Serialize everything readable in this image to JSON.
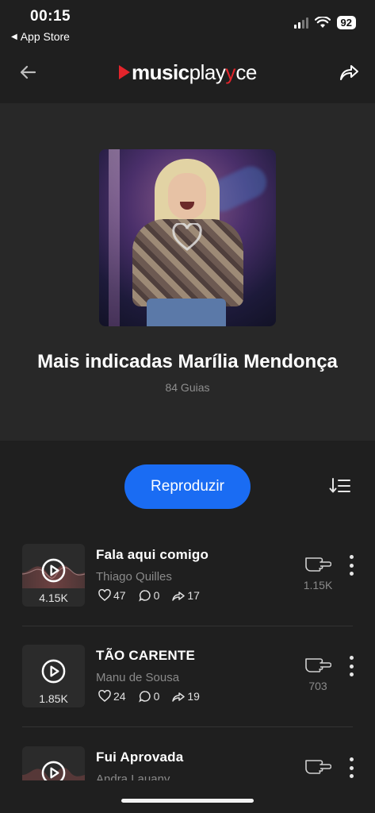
{
  "status_bar": {
    "time": "00:15",
    "back_app": "App Store",
    "battery": "92"
  },
  "header": {
    "logo_bold": "music",
    "logo_light": "play",
    "logo_accent": "y",
    "logo_tail": "ce"
  },
  "playlist": {
    "title": "Mais indicadas Marília Mendonça",
    "subtitle": "84 Guias"
  },
  "controls": {
    "play_label": "Reproduzir"
  },
  "tracks": [
    {
      "title": "Fala aqui comigo",
      "artist": "Thiago Quilles",
      "views": "4.15K",
      "likes": "47",
      "comments": "0",
      "shares": "17",
      "recommendations": "1.15K"
    },
    {
      "title": "TÃO CARENTE",
      "artist": "Manu de Sousa",
      "views": "1.85K",
      "likes": "24",
      "comments": "0",
      "shares": "19",
      "recommendations": "703"
    },
    {
      "title": "Fui Aprovada",
      "artist": "Andra Lauany",
      "views": "",
      "likes": "",
      "comments": "",
      "shares": "",
      "recommendations": ""
    }
  ],
  "colors": {
    "accent": "#1a6cf3",
    "brand_red": "#e3242b",
    "background": "#1f1f1f"
  }
}
